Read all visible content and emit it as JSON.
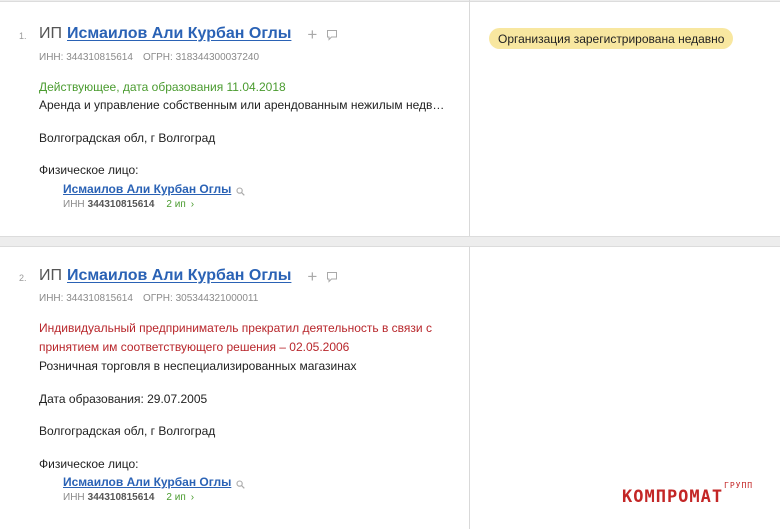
{
  "entries": [
    {
      "number": "1.",
      "prefix": "ИП",
      "name": "Исмаилов Али Курбан Оглы",
      "inn_label": "ИНН: 344310815614",
      "ogrn_label": "ОГРН: 318344300037240",
      "status": "Действующее, дата образования 11.04.2018",
      "activity": "Аренда и управление собственным или арендованным нежилым недв…",
      "region": "Волгоградская обл, г Волгоград",
      "person_label": "Физическое лицо:",
      "person_name": "Исмаилов Али Курбан Оглы",
      "person_inn_label": "ИНН",
      "person_inn": "344310815614",
      "person_ip_count": "2 ип",
      "badge": "Организация зарегистрирована недавно"
    },
    {
      "number": "2.",
      "prefix": "ИП",
      "name": "Исмаилов Али Курбан Оглы",
      "inn_label": "ИНН: 344310815614",
      "ogrn_label": "ОГРН: 305344321000011",
      "status": "Индивидуальный предприниматель прекратил деятельность в связи с принятием им соответствующего решения – 02.05.2006",
      "activity": "Розничная торговля в неспециализированных магазинах",
      "formation_date": "Дата образования: 29.07.2005",
      "region": "Волгоградская обл, г Волгоград",
      "person_label": "Физическое лицо:",
      "person_name": "Исмаилов Али Курбан Оглы",
      "person_inn_label": "ИНН",
      "person_inn": "344310815614",
      "person_ip_count": "2 ип"
    }
  ],
  "watermark": {
    "main": "КОМПРОМАТ",
    "sub": "ГРУПП"
  },
  "icons": [
    "plus-icon",
    "comment-icon",
    "search-icon",
    "chevron-right-icon"
  ],
  "colors": {
    "link": "#2a62b5",
    "active_status": "#4a9b2f",
    "closed_status": "#b8262b",
    "badge_bg": "#f8e7a0",
    "watermark": "#c32626"
  }
}
